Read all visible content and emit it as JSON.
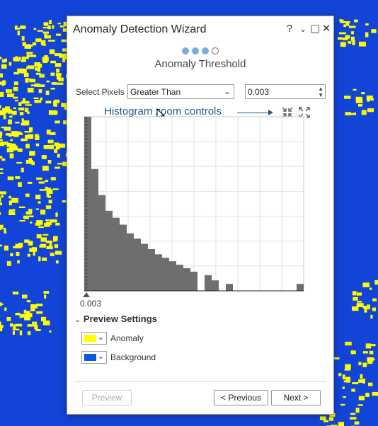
{
  "dialog": {
    "title": "Anomaly Detection Wizard",
    "window_controls": {
      "help": "?",
      "menu": "⌄",
      "maximize": "▢",
      "close": "✕"
    },
    "steps": {
      "total": 4,
      "completed": 3
    },
    "step_title": "Anomaly Threshold"
  },
  "select_pixels": {
    "label": "Select Pixels",
    "operator_value": "Greater Than",
    "threshold_value": "0.003"
  },
  "annotation": {
    "text": "Histogram zoom controls"
  },
  "histogram": {
    "threshold_label": "0.003",
    "chart_data": {
      "type": "bar",
      "values": [
        100,
        70,
        55,
        46,
        42,
        38,
        33,
        30,
        27,
        24,
        21,
        19,
        17,
        15,
        13,
        11,
        0,
        9,
        6,
        0,
        4,
        0,
        0,
        0,
        0,
        0,
        0,
        0,
        0,
        0,
        4
      ],
      "ylim": [
        0,
        100
      ],
      "grid": true
    }
  },
  "preview_settings": {
    "title": "Preview Settings",
    "items": [
      {
        "label": "Anomaly",
        "color": "#ffff00"
      },
      {
        "label": "Background",
        "color": "#0a58e0"
      }
    ]
  },
  "buttons": {
    "preview": "Preview",
    "previous": "< Previous",
    "next": "Next >"
  },
  "colors": {
    "background": "#1244d8",
    "anomaly_speckle": "#ffff00",
    "bar": "#6e6e6e",
    "accent": "#1f5b8f"
  }
}
